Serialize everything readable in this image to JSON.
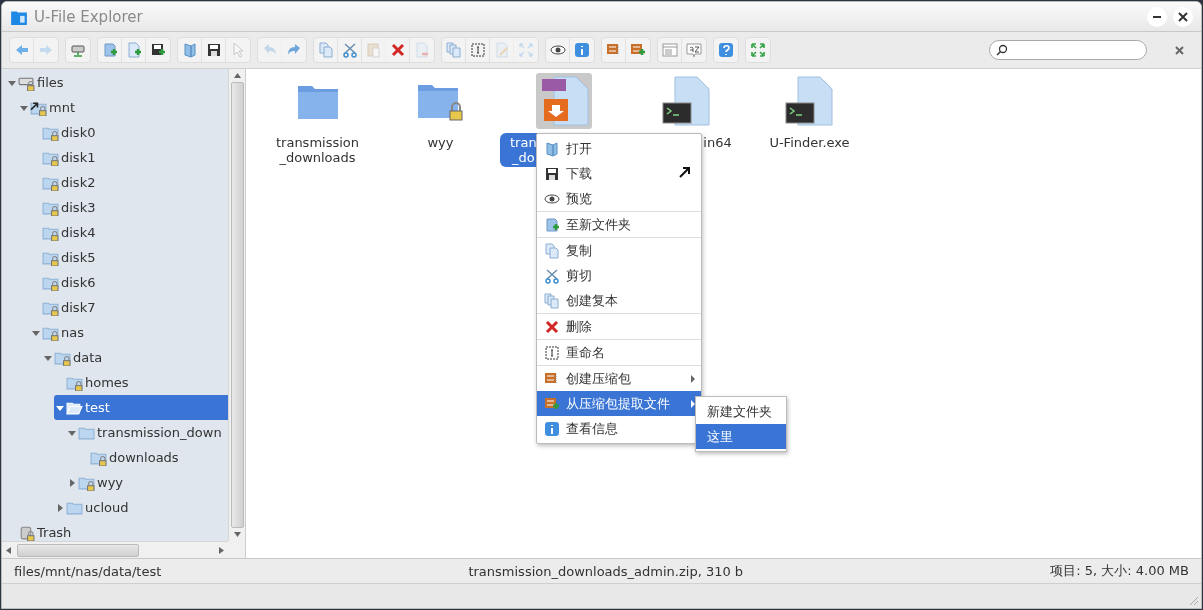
{
  "window": {
    "title": "U-File Explorer"
  },
  "toolbar": [
    {
      "buttons": [
        {
          "kind": "back",
          "disabled": false
        },
        {
          "kind": "forward",
          "disabled": true
        }
      ]
    },
    {
      "buttons": [
        {
          "kind": "netmount",
          "disabled": false
        }
      ]
    },
    {
      "buttons": [
        {
          "kind": "mkdir",
          "disabled": false
        },
        {
          "kind": "mkfile",
          "disabled": false
        },
        {
          "kind": "upload",
          "disabled": false
        }
      ]
    },
    {
      "buttons": [
        {
          "kind": "open",
          "disabled": false
        },
        {
          "kind": "download",
          "disabled": false
        },
        {
          "kind": "select",
          "disabled": true
        }
      ]
    },
    {
      "buttons": [
        {
          "kind": "undo",
          "disabled": true
        },
        {
          "kind": "redo",
          "disabled": false
        }
      ]
    },
    {
      "buttons": [
        {
          "kind": "copy",
          "disabled": false
        },
        {
          "kind": "cut",
          "disabled": false
        },
        {
          "kind": "paste",
          "disabled": true
        },
        {
          "kind": "delete",
          "disabled": false
        },
        {
          "kind": "remove",
          "disabled": true
        }
      ]
    },
    {
      "buttons": [
        {
          "kind": "duplicate",
          "disabled": false
        },
        {
          "kind": "rename",
          "disabled": false
        },
        {
          "kind": "edit",
          "disabled": true
        },
        {
          "kind": "resize",
          "disabled": true
        }
      ]
    },
    {
      "buttons": [
        {
          "kind": "preview",
          "disabled": false
        },
        {
          "kind": "info",
          "disabled": false
        }
      ]
    },
    {
      "buttons": [
        {
          "kind": "archive",
          "disabled": false
        },
        {
          "kind": "extract",
          "disabled": false
        }
      ]
    },
    {
      "buttons": [
        {
          "kind": "view",
          "disabled": false
        },
        {
          "kind": "sort",
          "disabled": false
        }
      ]
    },
    {
      "buttons": [
        {
          "kind": "help",
          "disabled": false
        }
      ]
    },
    {
      "buttons": [
        {
          "kind": "fullscreen",
          "disabled": false
        }
      ]
    }
  ],
  "tree": [
    {
      "label": "files",
      "kind": "drive",
      "expanded": true,
      "selected": false,
      "children": [
        {
          "label": "mnt",
          "kind": "link",
          "expanded": true,
          "selected": false,
          "children": [
            {
              "label": "disk0",
              "kind": "locked",
              "selected": false
            },
            {
              "label": "disk1",
              "kind": "locked",
              "selected": false
            },
            {
              "label": "disk2",
              "kind": "locked",
              "selected": false
            },
            {
              "label": "disk3",
              "kind": "locked",
              "selected": false
            },
            {
              "label": "disk4",
              "kind": "locked",
              "selected": false
            },
            {
              "label": "disk5",
              "kind": "locked",
              "selected": false
            },
            {
              "label": "disk6",
              "kind": "locked",
              "selected": false
            },
            {
              "label": "disk7",
              "kind": "locked",
              "selected": false
            },
            {
              "label": "nas",
              "kind": "locked",
              "expanded": true,
              "selected": false,
              "children": [
                {
                  "label": "data",
                  "kind": "locked",
                  "expanded": true,
                  "selected": false,
                  "children": [
                    {
                      "label": "homes",
                      "kind": "locked",
                      "selected": false
                    },
                    {
                      "label": "test",
                      "kind": "open",
                      "expanded": true,
                      "selected": true,
                      "children": [
                        {
                          "label": "transmission_down",
                          "kind": "folder",
                          "expanded": true,
                          "selected": false,
                          "children": [
                            {
                              "label": "downloads",
                              "kind": "locked",
                              "selected": false
                            }
                          ]
                        },
                        {
                          "label": "wyy",
                          "kind": "locked",
                          "expanded": false,
                          "selected": false
                        }
                      ]
                    },
                    {
                      "label": "ucloud",
                      "kind": "folder",
                      "expanded": false,
                      "selected": false
                    }
                  ]
                }
              ]
            }
          ]
        }
      ]
    },
    {
      "label": "Trash",
      "kind": "trash",
      "selected": false
    }
  ],
  "files": [
    {
      "kind": "folder",
      "lines": [
        "transmission",
        "_downloads"
      ],
      "selected": false
    },
    {
      "kind": "locked",
      "lines": [
        "wyy"
      ],
      "selected": false
    },
    {
      "kind": "zip",
      "lines": [
        "tran",
        "_do"
      ],
      "selected": true
    },
    {
      "kind": "exe",
      "lines": [
        "in64"
      ],
      "selected": false
    },
    {
      "kind": "exe",
      "lines": [
        "U-Finder.exe"
      ],
      "selected": false
    }
  ],
  "context_menu": {
    "groups": [
      [
        {
          "label": "打开",
          "kind": "open",
          "submenu": false,
          "selected": false
        },
        {
          "label": "下载",
          "kind": "download",
          "submenu": false,
          "selected": false
        },
        {
          "label": "预览",
          "kind": "preview",
          "submenu": false,
          "selected": false
        }
      ],
      [
        {
          "label": "至新文件夹",
          "kind": "tofolder",
          "submenu": false,
          "selected": false
        }
      ],
      [
        {
          "label": "复制",
          "kind": "copy",
          "submenu": false,
          "selected": false
        },
        {
          "label": "剪切",
          "kind": "cut",
          "submenu": false,
          "selected": false
        },
        {
          "label": "创建复本",
          "kind": "duplicate",
          "submenu": false,
          "selected": false
        }
      ],
      [
        {
          "label": "删除",
          "kind": "delete",
          "submenu": false,
          "selected": false
        }
      ],
      [
        {
          "label": "重命名",
          "kind": "rename",
          "submenu": false,
          "selected": false
        }
      ],
      [
        {
          "label": "创建压缩包",
          "kind": "archive",
          "submenu": true,
          "selected": false
        },
        {
          "label": "从压缩包提取文件",
          "kind": "extract",
          "submenu": true,
          "selected": true
        },
        {
          "label": "查看信息",
          "kind": "info",
          "submenu": false,
          "selected": false
        }
      ]
    ],
    "submenu": [
      {
        "label": "新建文件夹",
        "selected": false
      },
      {
        "label": "这里",
        "selected": true
      }
    ]
  },
  "status_bar": {
    "path": "files/mnt/nas/data/test",
    "selection": "transmission_downloads_admin.zip, 310 b",
    "summary": "项目: 5, 大小: 4.00 MB"
  }
}
